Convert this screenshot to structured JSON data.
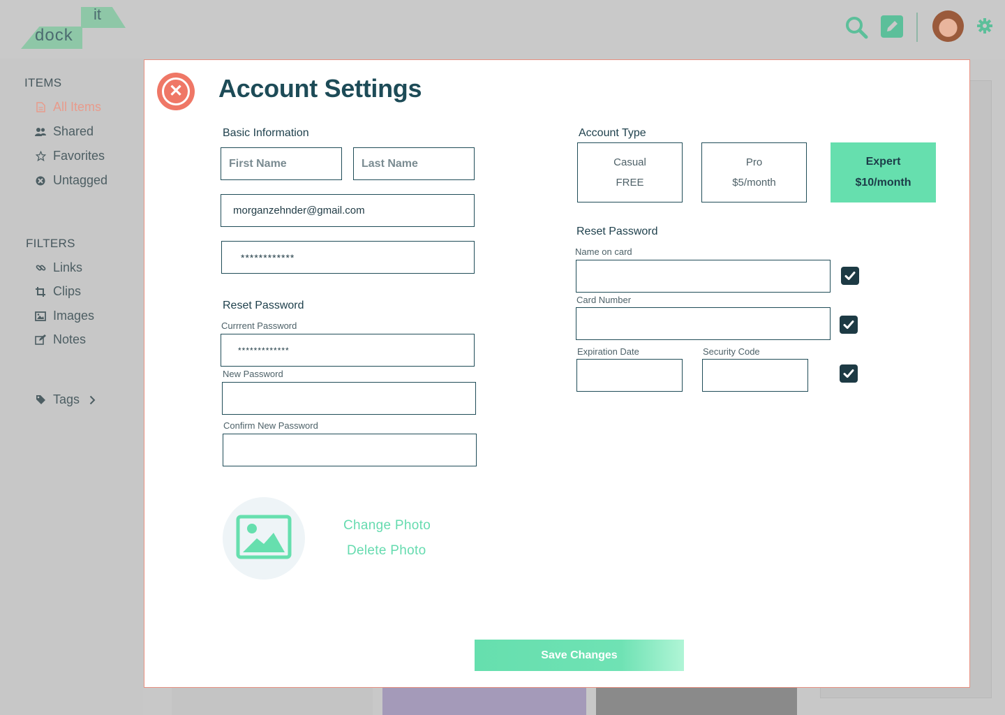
{
  "app": {
    "logo_top": "it",
    "logo_bottom": "dock"
  },
  "topbar": {
    "icons": [
      "search-icon",
      "edit-icon",
      "gear-icon"
    ],
    "accent": "#5cbf9a"
  },
  "sidebar": {
    "items_heading": "ITEMS",
    "items": [
      {
        "label": "All Items",
        "icon": "document-icon",
        "active": true
      },
      {
        "label": "Shared",
        "icon": "users-icon"
      },
      {
        "label": "Favorites",
        "icon": "star-icon"
      },
      {
        "label": "Untagged",
        "icon": "untagged-icon"
      }
    ],
    "filters_heading": "FILTERS",
    "filters": [
      {
        "label": "Links",
        "icon": "link-icon"
      },
      {
        "label": "Clips",
        "icon": "crop-icon"
      },
      {
        "label": "Images",
        "icon": "image-icon"
      },
      {
        "label": "Notes",
        "icon": "note-icon"
      }
    ],
    "tags_label": "Tags"
  },
  "modal": {
    "title": "Account Settings",
    "basic_info": {
      "heading": "Basic Information",
      "first_name_placeholder": "First Name",
      "last_name_placeholder": "Last Name",
      "email_value": "morganzehnder@gmail.com",
      "password_value": "************"
    },
    "reset_password": {
      "heading": "Reset Password",
      "current_label": "Currrent Password",
      "current_value": "*************",
      "new_label": "New Password",
      "confirm_label": "Confirm New Password"
    },
    "photo": {
      "change_label": "Change Photo",
      "delete_label": "Delete Photo"
    },
    "account_type": {
      "heading": "Account Type",
      "options": [
        {
          "name": "Casual",
          "price": "FREE",
          "selected": false
        },
        {
          "name": "Pro",
          "price": "$5/month",
          "selected": false
        },
        {
          "name": "Expert",
          "price": "$10/month",
          "selected": true
        }
      ]
    },
    "payment": {
      "heading": "Reset Password",
      "name_on_card_label": "Name on card",
      "card_number_label": "Card Number",
      "expiration_label": "Expiration Date",
      "security_code_label": "Security Code",
      "checks": [
        true,
        true,
        true
      ]
    },
    "save_label": "Save Changes"
  },
  "colors": {
    "accent_green": "#66dfae",
    "close_red": "#ef7766",
    "navy": "#1d4b57"
  }
}
